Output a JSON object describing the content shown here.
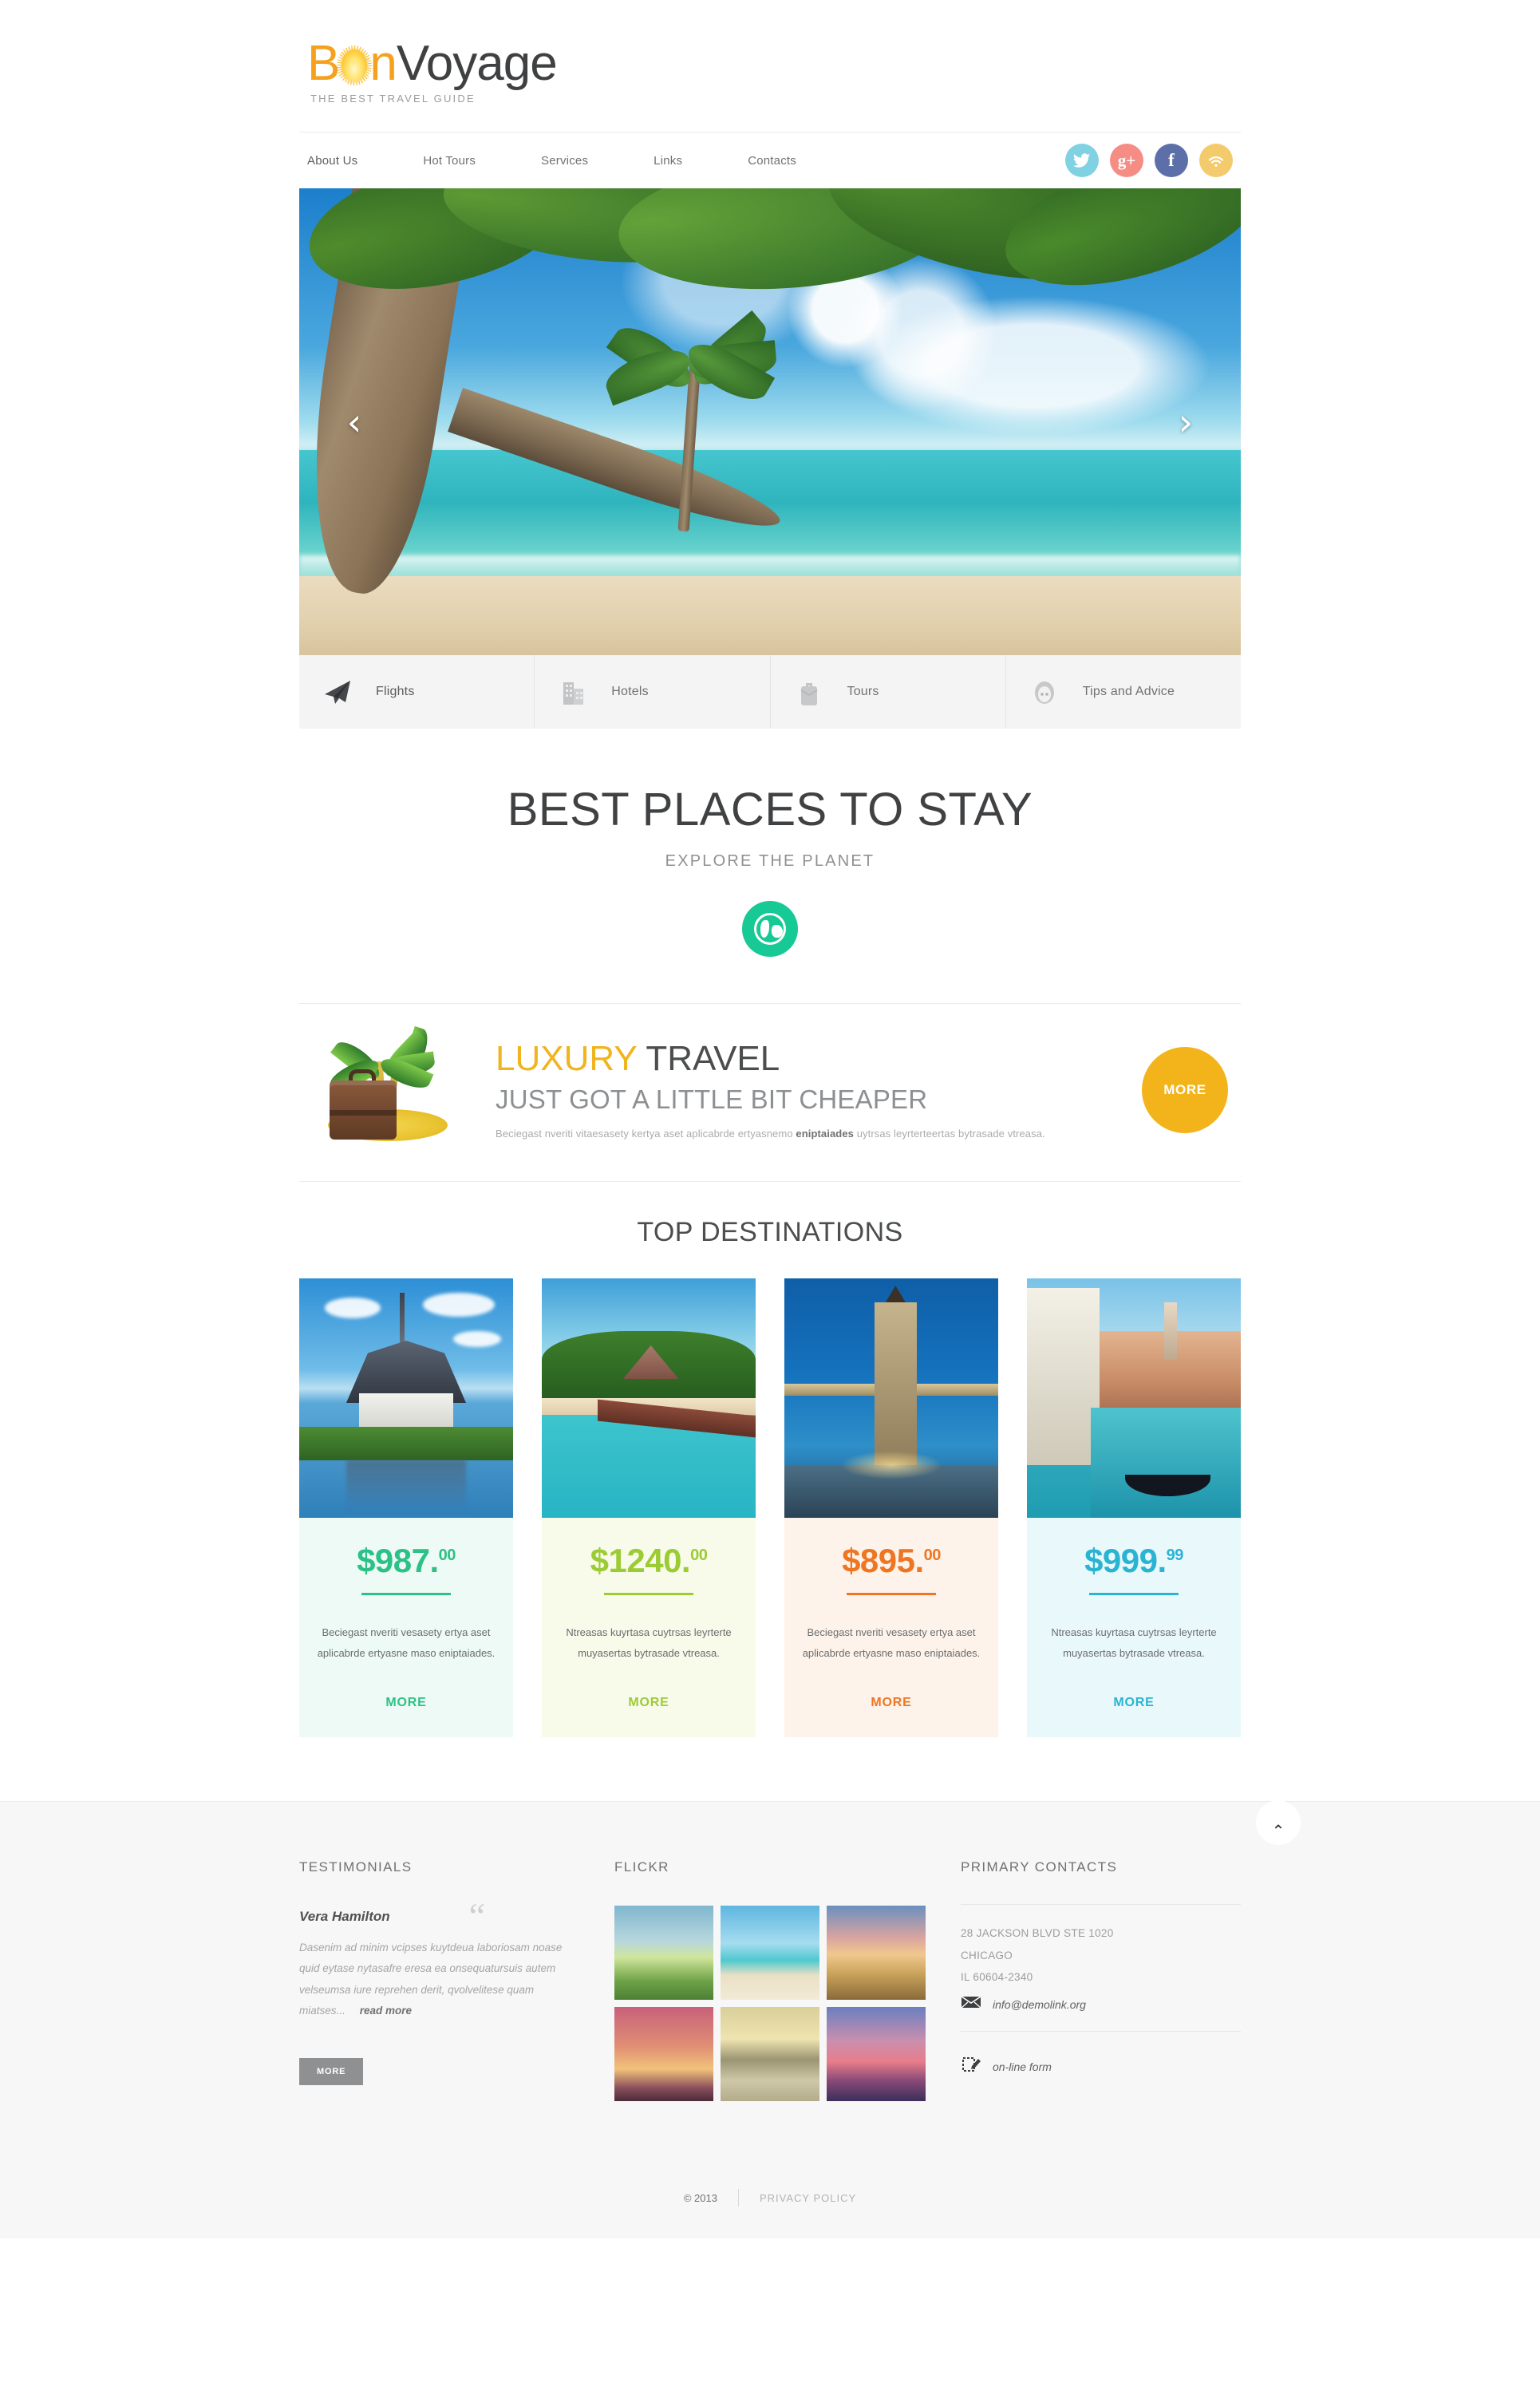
{
  "brand": {
    "name_part1": "Bon",
    "name_part2": "Voyage",
    "tagline": "THE BEST TRAVEL GUIDE"
  },
  "nav": {
    "items": [
      {
        "label": "About Us"
      },
      {
        "label": "Hot Tours"
      },
      {
        "label": "Services"
      },
      {
        "label": "Links"
      },
      {
        "label": "Contacts"
      }
    ]
  },
  "social": [
    {
      "name": "twitter",
      "glyph": "",
      "color": "#80d2e2"
    },
    {
      "name": "google-plus",
      "glyph": "g+",
      "color": "#f68d85"
    },
    {
      "name": "facebook",
      "glyph": "f",
      "color": "#5c6fa9"
    },
    {
      "name": "rss",
      "glyph": "",
      "color": "#f3cb6c"
    }
  ],
  "slider": {
    "prev_arrow": "‹",
    "next_arrow": "›",
    "alt": "Tropical beach with palm trees and longtail boat"
  },
  "tabs": [
    {
      "label": "Flights",
      "icon": "paper-plane-icon",
      "active": true
    },
    {
      "label": "Hotels",
      "icon": "buildings-icon",
      "active": false
    },
    {
      "label": "Tours",
      "icon": "briefcase-icon",
      "active": false
    },
    {
      "label": "Tips and Advice",
      "icon": "face-icon",
      "active": false
    }
  ],
  "hero": {
    "heading": "BEST PLACES TO STAY",
    "subheading": "EXPLORE THE PLANET",
    "icon": "globe-icon",
    "icon_color": "#16c995"
  },
  "luxury": {
    "title_highlight": "LUXURY",
    "title_rest": "TRAVEL",
    "subtitle": "JUST GOT A LITTLE BIT CHEAPER",
    "text_before": "Beciegast nveriti vitaesasety kertya aset aplicabrde ertyasnemo ",
    "text_bold": "eniptaiades",
    "text_after": " uytrsas leyrterteertas bytrasade vtreasa.",
    "button_label": "MORE",
    "button_color": "#f3b41b",
    "highlight_color": "#f0b41e"
  },
  "destinations": {
    "heading": "TOP DESTINATIONS",
    "cards": [
      {
        "image": "thai-temple",
        "price_main": "$987.",
        "price_cents": "00",
        "color": "#2cc186",
        "bg": "#eefaf5",
        "desc": "Beciegast nveriti vesasety ertya aset aplicabrde ertyasne maso eniptaiades.",
        "more_label": "MORE"
      },
      {
        "image": "tropical-pier",
        "price_main": "$1240.",
        "price_cents": "00",
        "color": "#9ccc35",
        "bg": "#f8faea",
        "desc": "Ntreasas kuyrtasa cuytrsas leyrterte muyasertas bytrasade vtreasa.",
        "more_label": "MORE"
      },
      {
        "image": "tower-bridge",
        "price_main": "$895.",
        "price_cents": "00",
        "color": "#ee7623",
        "bg": "#fdf3eb",
        "desc": "Beciegast nveriti vesasety ertya aset aplicabrde ertyasne maso eniptaiades.",
        "more_label": "MORE"
      },
      {
        "image": "venice-canal",
        "price_main": "$999.",
        "price_cents": "99",
        "color": "#2ab4d3",
        "bg": "#e9f8fa",
        "desc": "Ntreasas kuyrtasa cuytrsas leyrterte muyasertas bytrasade vtreasa.",
        "more_label": "MORE"
      }
    ]
  },
  "footer": {
    "testimonials": {
      "title": "TESTIMONIALS",
      "author": "Vera Hamilton",
      "quote_mark": "“",
      "text": "Dasenim ad minim vcipses kuytdeua laboriosam noase quid eytase nytasafre eresa ea onsequatursuis autem velseumsa iure reprehen derit, qvolvelitese quam miatses...",
      "read_more": "read more",
      "button_label": "MORE"
    },
    "flickr": {
      "title": "FLICKR",
      "thumbs": [
        {
          "name": "sunrise-field"
        },
        {
          "name": "beach-umbrella"
        },
        {
          "name": "sunset-bay"
        },
        {
          "name": "palm-sunset"
        },
        {
          "name": "rocky-beach"
        },
        {
          "name": "lighthouse-sunset"
        }
      ]
    },
    "contacts": {
      "title": "PRIMARY CONTACTS",
      "address_line1": "28 JACKSON BLVD STE 1020",
      "address_line2": "CHICAGO",
      "address_line3": "IL 60604-2340",
      "email": "info@demolink.org",
      "form_link": "on-line form"
    },
    "back_to_top": "⌃",
    "copyright": "© 2013",
    "privacy": "PRIVACY POLICY"
  }
}
